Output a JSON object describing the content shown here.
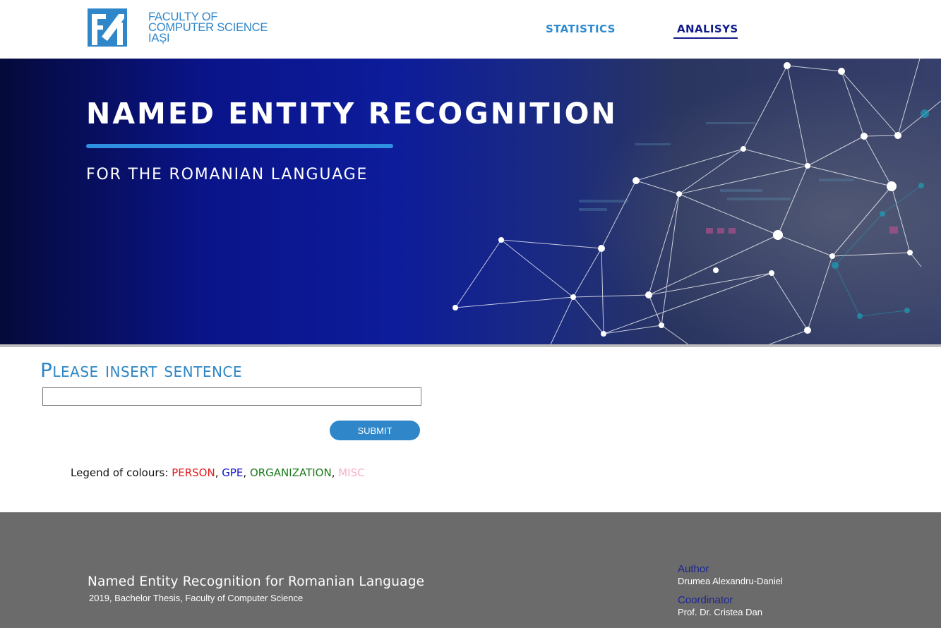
{
  "header": {
    "logo_lines": [
      "FACULTY OF",
      "COMPUTER SCIENCE",
      "IAȘI"
    ],
    "nav": {
      "statistics": "STATISTICS",
      "analysis": "ANALISYS"
    },
    "colors": {
      "brand": "#2f86c9",
      "active_nav": "#121d8a"
    }
  },
  "hero": {
    "title": "NAMED ENTITY RECOGNITION",
    "subtitle": "FOR THE ROMANIAN LANGUAGE"
  },
  "form": {
    "title": "Please insert sentence",
    "input_value": "",
    "submit_label": "SUBMIT"
  },
  "legend": {
    "label": "Legend of colours: ",
    "entries": [
      {
        "name": "PERSON",
        "color": "#e01c1c"
      },
      {
        "name": "GPE",
        "color": "#1010c8"
      },
      {
        "name": "ORGANIZATION",
        "color": "#1a7a1a"
      },
      {
        "name": "MISC",
        "color": "#f4b0c0"
      }
    ],
    "separator": ", "
  },
  "footer": {
    "title": "Named Entity Recognition for Romanian Language",
    "subtitle": "2019, Bachelor Thesis, Faculty of Computer Science",
    "author_label": "Author",
    "author_name": "Drumea Alexandru-Daniel",
    "coordinator_label": "Coordinator",
    "coordinator_name": "Prof. Dr. Cristea Dan"
  }
}
